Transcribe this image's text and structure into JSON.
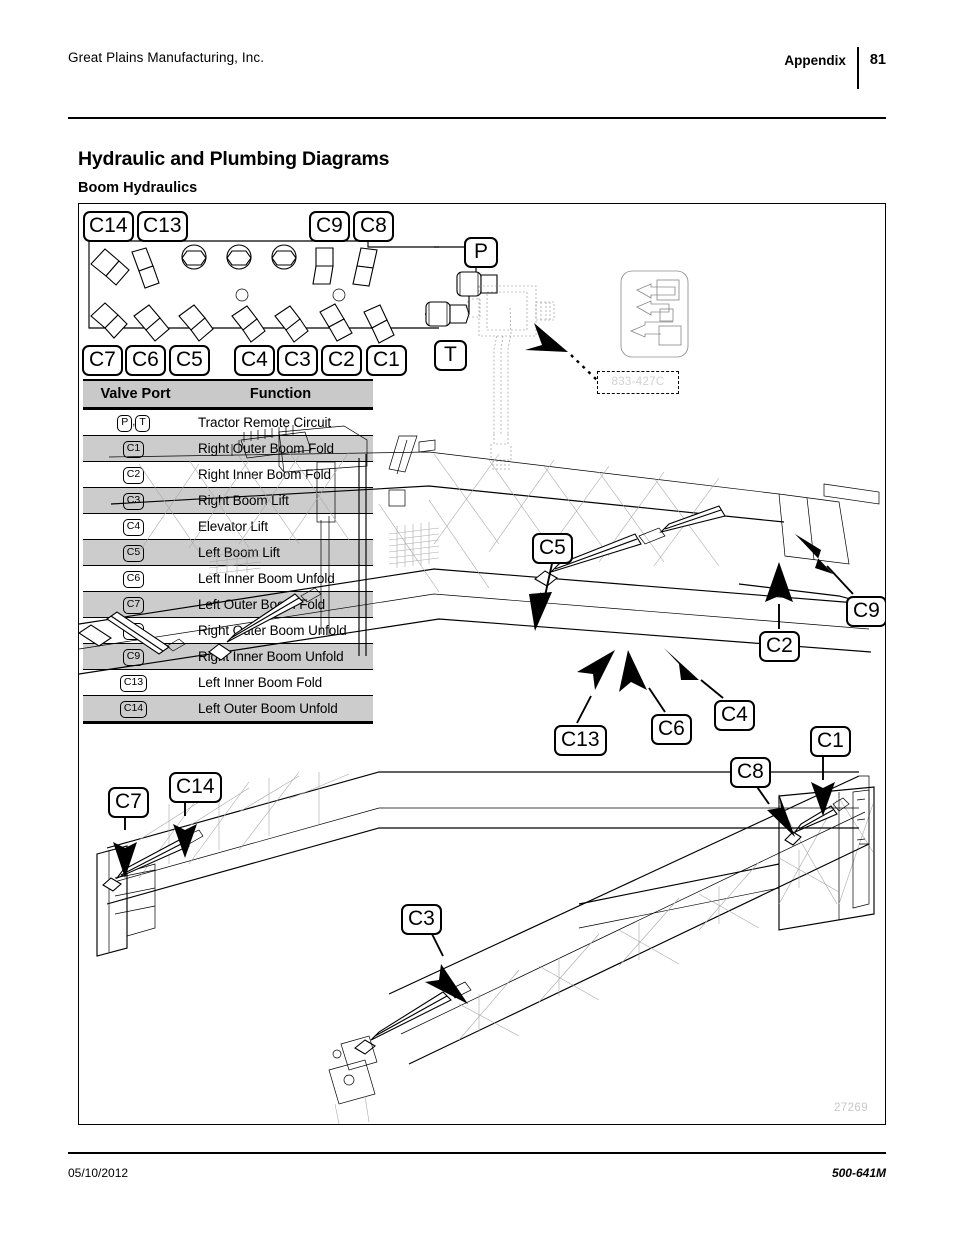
{
  "header": {
    "company": "Great Plains Manufacturing, Inc.",
    "chapter": "Appendix",
    "page_number": "81"
  },
  "titles": {
    "main": "Hydraulic and Plumbing Diagrams",
    "sub": "Boom Hydraulics"
  },
  "table": {
    "columns": [
      "Valve Port",
      "Function"
    ],
    "rows": [
      {
        "port": "P,T",
        "port_parts": [
          "P",
          "T"
        ],
        "function": "Tractor Remote Circuit",
        "shaded": false
      },
      {
        "port": "C1",
        "function": "Right Outer Boom Fold",
        "shaded": true
      },
      {
        "port": "C2",
        "function": "Right Inner Boom Fold",
        "shaded": false
      },
      {
        "port": "C3",
        "function": "Right Boom Lift",
        "shaded": true
      },
      {
        "port": "C4",
        "function": "Elevator Lift",
        "shaded": false
      },
      {
        "port": "C5",
        "function": "Left Boom Lift",
        "shaded": true
      },
      {
        "port": "C6",
        "function": "Left Inner Boom Unfold",
        "shaded": false
      },
      {
        "port": "C7",
        "function": "Left Outer Boom Fold",
        "shaded": true
      },
      {
        "port": "C8",
        "function": "Right Outer Boom Unfold",
        "shaded": false
      },
      {
        "port": "C9",
        "function": "Right Inner Boom Unfold",
        "shaded": true
      },
      {
        "port": "C13",
        "function": "Left Inner Boom Fold",
        "shaded": false
      },
      {
        "port": "C14",
        "function": "Left Outer Boom Unfold",
        "shaded": true
      }
    ]
  },
  "valve_block": {
    "top_tags": [
      "C14",
      "C13",
      "C9",
      "C8"
    ],
    "bottom_tags": [
      "C7",
      "C6",
      "C5",
      "C4",
      "C3",
      "C2",
      "C1"
    ],
    "supply_tag": "P",
    "return_tag": "T",
    "part_number": "833-427C"
  },
  "boom_callouts": {
    "upper": [
      "C5",
      "C9",
      "C2",
      "C13",
      "C6",
      "C4",
      "C1",
      "C8"
    ],
    "lower": [
      "C7",
      "C14",
      "C3"
    ]
  },
  "figure": {
    "number": "27269"
  },
  "footer": {
    "date": "05/10/2012",
    "document_number": "500-641M"
  }
}
